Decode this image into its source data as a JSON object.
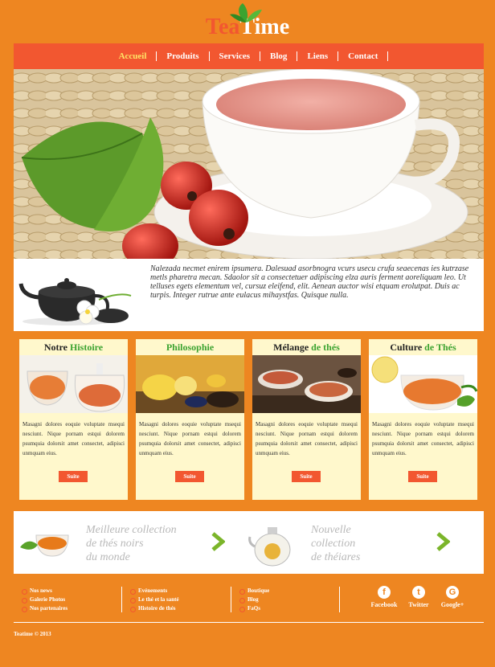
{
  "logo": {
    "tea": "Tea",
    "time": "Time"
  },
  "nav": {
    "items": [
      {
        "label": "Accueil",
        "active": true
      },
      {
        "label": "Produits"
      },
      {
        "label": "Services"
      },
      {
        "label": "Blog"
      },
      {
        "label": "Liens"
      },
      {
        "label": "Contact"
      }
    ]
  },
  "intro": {
    "text": "Nalezada necmet enirem ipsumera. Dalesuad asorbnogra vcurs usecu crufa seaecenas ies kutrzase metls pharetra mecan. Sdaolor sit a consectetuer adipiscing elza auris ferment aoreliquam leo. Ut telluses egets elementum vel, cursuz eleifend, elit. Aenean auctor wisi etquam erolutpat. Duis ac turpis. Integer rutrue ante eulacus mihaystfas. Quisque nulla."
  },
  "cards": [
    {
      "title_a": "Notre ",
      "title_b": "Histoire",
      "text": "Masagni dolores eoquie voluptate msequi nesciunt. Nique pornam estqui dolorem psumquia dolorsit amet consectet, adipisci unmquam eius.",
      "button": "Suite"
    },
    {
      "title_a": "",
      "title_b": "Philosophie",
      "text": "Masagni dolores eoquie voluptate msequi nesciunt. Nique pornam estqui dolorem psumquia dolorsit amet consectet, adipisci unmquam eius.",
      "button": "Suite"
    },
    {
      "title_a": "Mélange ",
      "title_b": "de thés",
      "text": "Masagni dolores eoquie voluptate msequi nesciunt. Nique pornam estqui dolorem psumquia dolorsit amet consectet, adipisci unmquam eius.",
      "button": "Suite"
    },
    {
      "title_a": "Culture ",
      "title_b": "de Thés",
      "text": "Masagni dolores eoquie voluptate msequi nesciunt. Nique pornam estqui dolorem psumquia dolorsit amet consectet, adipisci unmquam eius.",
      "button": "Suite"
    }
  ],
  "promo": {
    "left": {
      "line1": "Meilleure collection",
      "line2": "de thés noirs",
      "line3": "du monde"
    },
    "right": {
      "line1": "Nouvelle",
      "line2": "collection",
      "line3": "de théiares"
    }
  },
  "footer": {
    "col1": [
      "Nos news",
      "Galerie Photos",
      "Nos partenaires"
    ],
    "col2": [
      "Evénements",
      "Le thé et la santé",
      "Histoire de thés"
    ],
    "col3": [
      "Boutique",
      "Blog",
      "FaQs"
    ],
    "social": [
      {
        "label": "Facebook",
        "glyph": "f"
      },
      {
        "label": "Twitter",
        "glyph": "t"
      },
      {
        "label": "Google+",
        "glyph": "G"
      }
    ],
    "copyright": "Teatime © 2013"
  },
  "colors": {
    "background": "#ee8621",
    "accent": "#f25730",
    "card": "#fff8cc",
    "green": "#3ca330",
    "active_nav": "#ffe566"
  }
}
